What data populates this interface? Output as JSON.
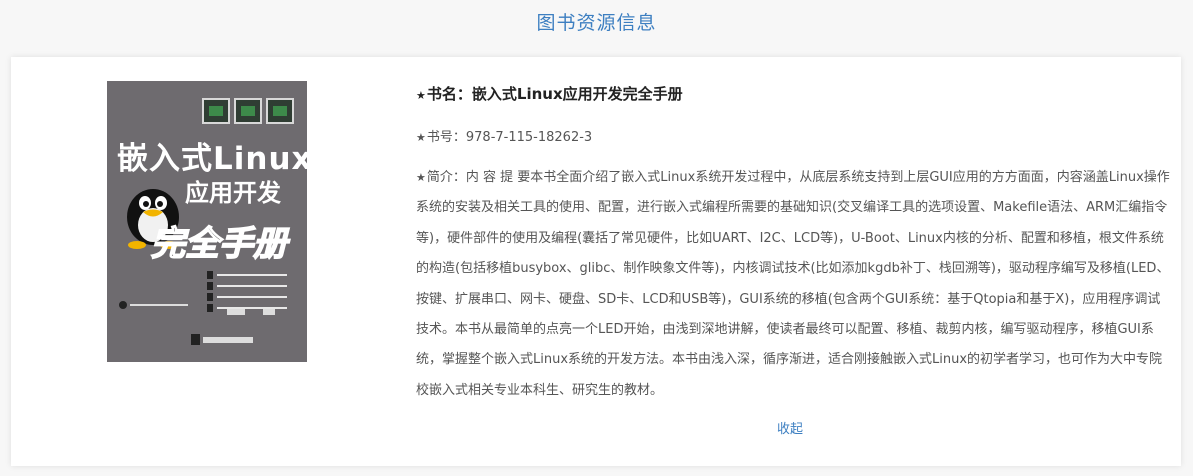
{
  "header": {
    "title": "图书资源信息"
  },
  "book": {
    "cover": {
      "title_line1": "嵌入式Linux",
      "title_line2": "应用开发",
      "title_line3": "完全手册"
    },
    "star": "★",
    "name_label": "书名：",
    "name_value": "嵌入式Linux应用开发完全手册",
    "isbn_label": "书号：",
    "isbn_value": "978-7-115-18262-3",
    "summary_label": "简介：",
    "summary_value": "内 容 提 要本书全面介绍了嵌入式Linux系统开发过程中，从底层系统支持到上层GUI应用的方方面面，内容涵盖Linux操作系统的安装及相关工具的使用、配置，进行嵌入式编程所需要的基础知识(交叉编译工具的选项设置、Makefile语法、ARM汇编指令等)，硬件部件的使用及编程(囊括了常见硬件，比如UART、I2C、LCD等)，U-Boot、Linux内核的分析、配置和移植，根文件系统的构造(包括移植busybox、glibc、制作映象文件等)，内核调试技术(比如添加kgdb补丁、栈回溯等)，驱动程序编写及移植(LED、按键、扩展串口、网卡、硬盘、SD卡、LCD和USB等)，GUI系统的移植(包含两个GUI系统：基于Qtopia和基于X)，应用程序调试技术。本书从最简单的点亮一个LED开始，由浅到深地讲解，使读者最终可以配置、移植、裁剪内核，编写驱动程序，移植GUI系统，掌握整个嵌入式Linux系统的开发方法。本书由浅入深，循序渐进，适合刚接触嵌入式Linux的初学者学习，也可作为大中专院校嵌入式相关专业本科生、研究生的教材。"
  },
  "actions": {
    "collapse_label": "收起"
  },
  "colors": {
    "accent": "#3d7fc1",
    "background": "#f7f7f7",
    "card": "#ffffff",
    "cover": "#6e6b6f"
  }
}
